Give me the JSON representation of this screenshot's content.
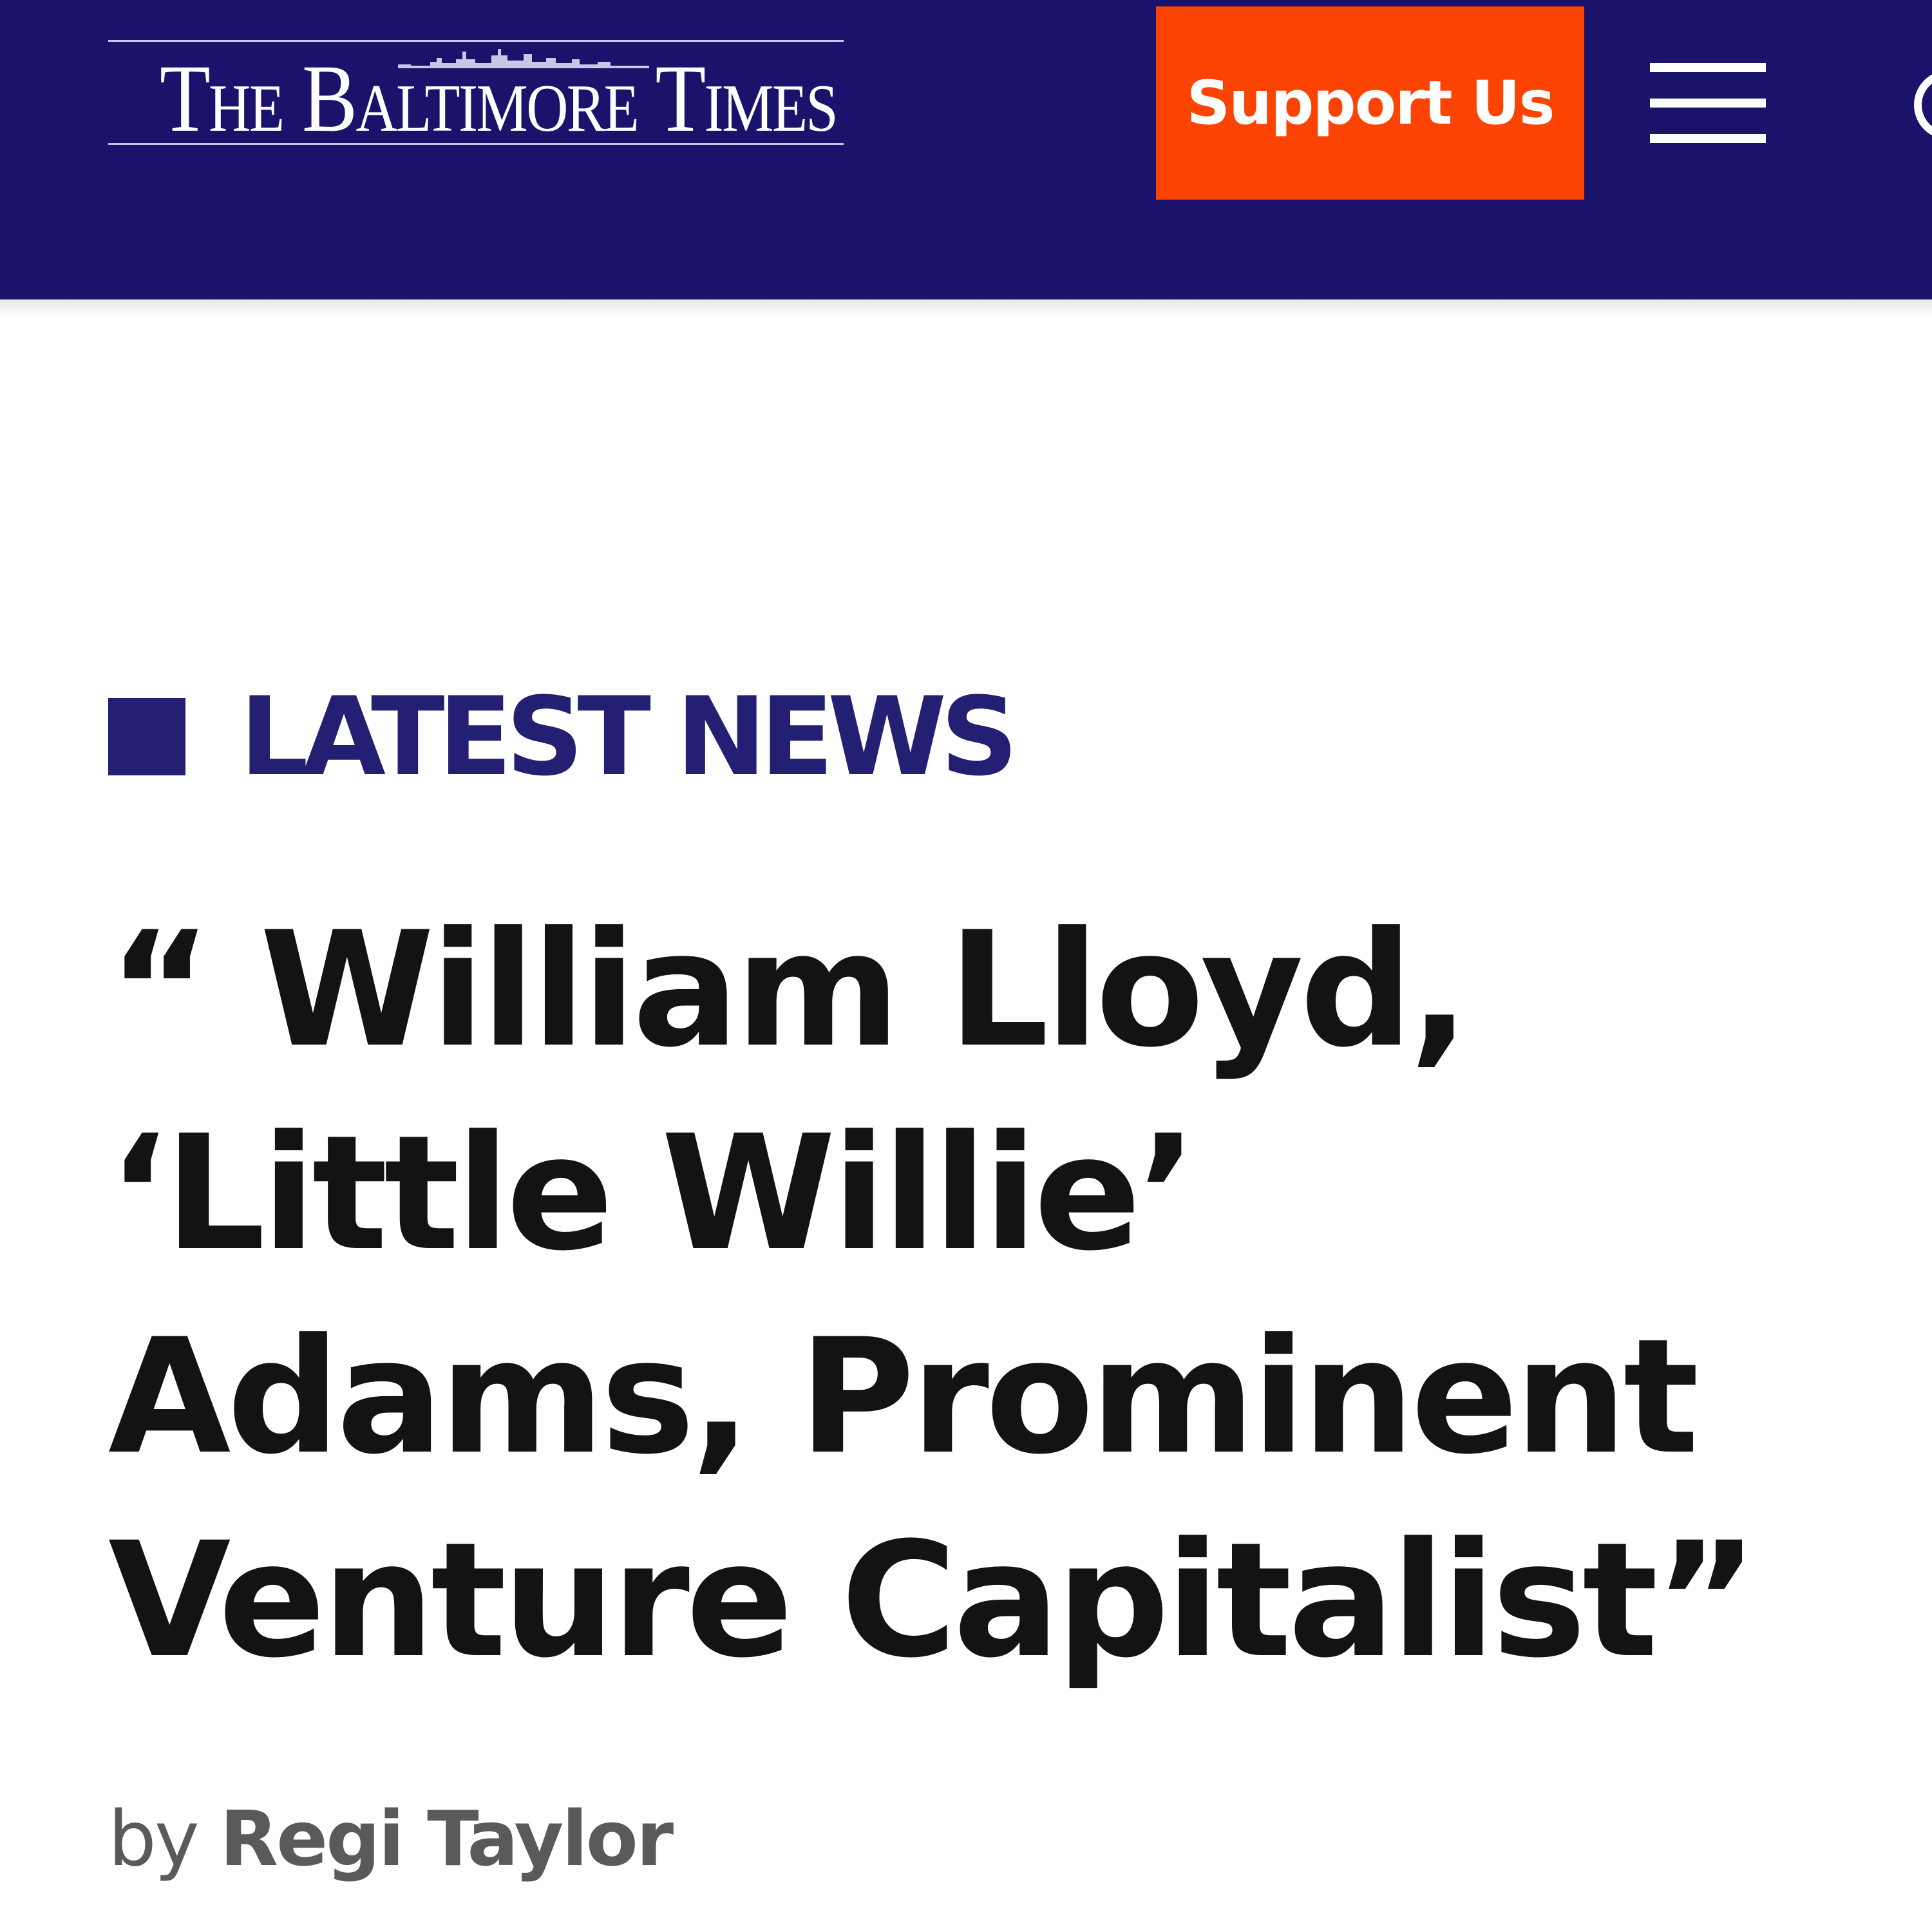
{
  "header": {
    "logo_text": "The Baltimore Times",
    "support_label": "Support Us",
    "menu_icon": "hamburger-menu-icon",
    "edge_icon": "search-icon",
    "colors": {
      "background": "#1a126b",
      "support_button": "#fb4403",
      "text": "#ffffff"
    }
  },
  "article": {
    "category": "LATEST NEWS",
    "headline": "“ William Lloyd, ‘Little Willie’ Adams, Prominent Venture Capitalist”",
    "byline_prefix": "by",
    "author": "Regi Taylor",
    "colors": {
      "category": "#231f72",
      "headline": "#131313",
      "byline": "#5a5a5a"
    }
  }
}
